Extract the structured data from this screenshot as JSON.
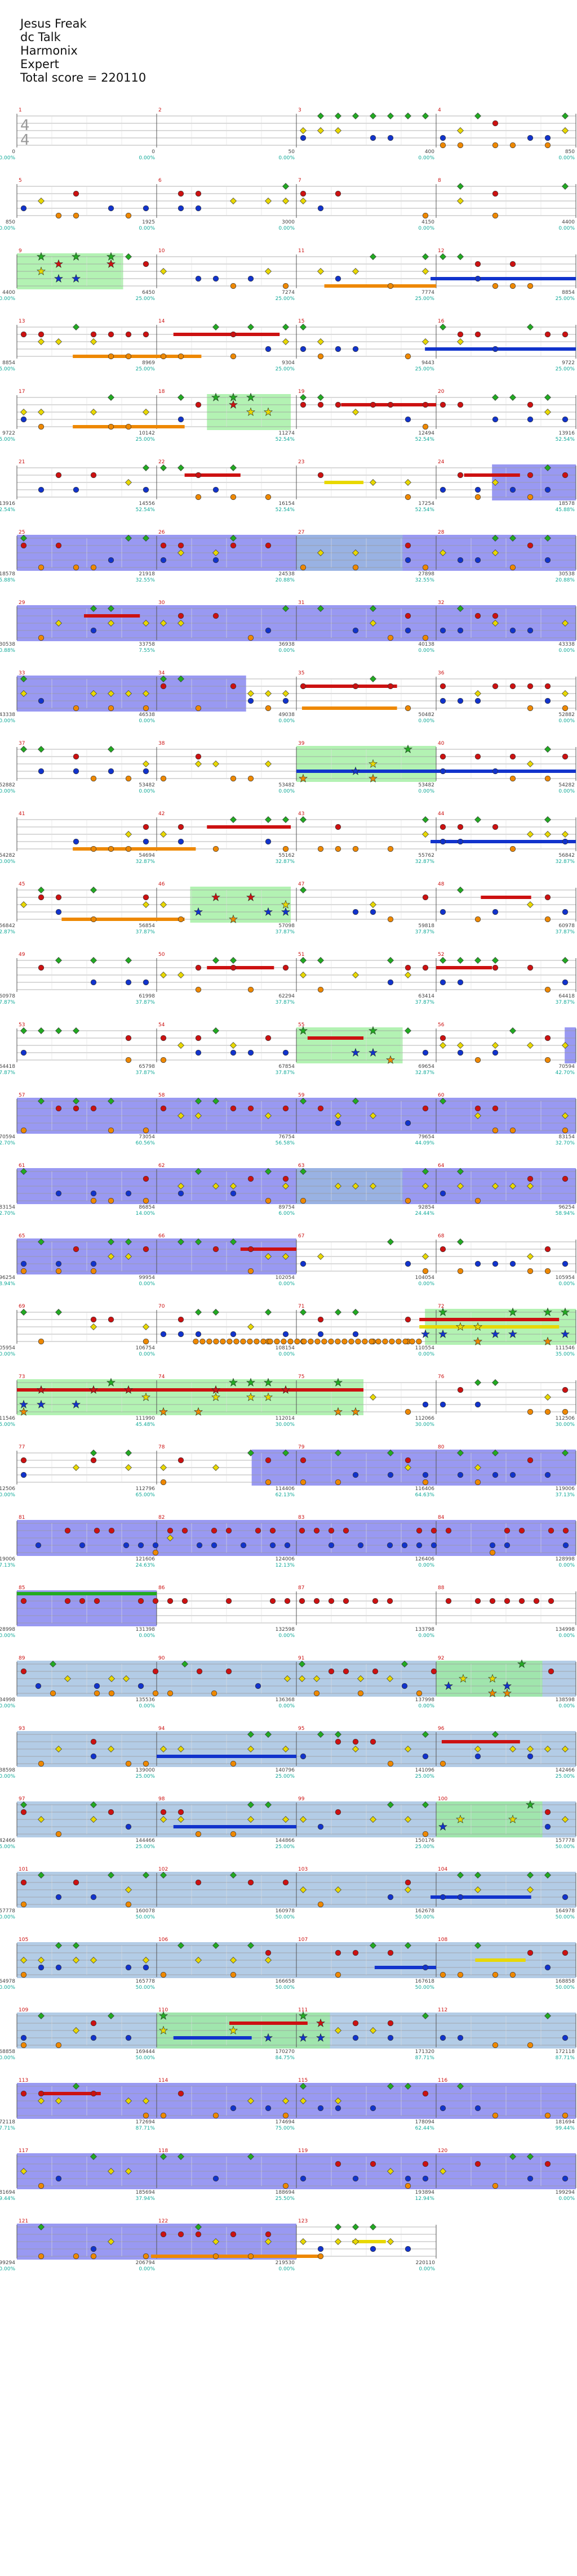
{
  "song": {
    "title": "Jesus Freak",
    "artist": "dc Talk",
    "charter": "Harmonix",
    "difficulty": "Expert",
    "total_score_text": "Total score = 220110"
  },
  "time_signature": "4/4",
  "lane_colors": [
    "#22aa22",
    "#cc1111",
    "#e8d800",
    "#1133cc",
    "#ee8800"
  ],
  "overlay_colors": {
    "star_power": "#99ee99",
    "overdrive": "#7777ee",
    "solo": "#99bbdd"
  },
  "rows": [
    {
      "bars": [
        {
          "n": 1,
          "score": "0",
          "pct": "0.00%"
        },
        {
          "n": 2,
          "score": "0",
          "pct": "0.00%"
        },
        {
          "n": 3,
          "score": "50",
          "pct": "0.00%"
        },
        {
          "n": 4,
          "score": "400",
          "pct": "0.00%"
        }
      ],
      "end_score": "850",
      "end_pct": "0.00%"
    },
    {
      "bars": [
        {
          "n": 5,
          "score": "850",
          "pct": "0.00%"
        },
        {
          "n": 6,
          "score": "1925",
          "pct": "0.00%"
        },
        {
          "n": 7,
          "score": "3000",
          "pct": "0.00%"
        },
        {
          "n": 8,
          "score": "4150",
          "pct": "0.00%"
        }
      ],
      "end_score": "4400",
      "end_pct": "0.00%"
    },
    {
      "bars": [
        {
          "n": 9,
          "score": "4400",
          "pct": "0.00%"
        },
        {
          "n": 10,
          "score": "6450",
          "pct": "25.00%"
        },
        {
          "n": 11,
          "score": "7274",
          "pct": "25.00%"
        },
        {
          "n": 12,
          "score": "7774",
          "pct": "25.00%"
        }
      ],
      "end_score": "8854",
      "end_pct": "25.00%"
    },
    {
      "bars": [
        {
          "n": 13,
          "score": "8854",
          "pct": "25.00%"
        },
        {
          "n": 14,
          "score": "8969",
          "pct": "25.00%"
        },
        {
          "n": 15,
          "score": "9304",
          "pct": "25.00%"
        },
        {
          "n": 16,
          "score": "9443",
          "pct": "25.00%"
        }
      ],
      "end_score": "9722",
      "end_pct": "25.00%"
    },
    {
      "bars": [
        {
          "n": 17,
          "score": "9722",
          "pct": "25.00%"
        },
        {
          "n": 18,
          "score": "10142",
          "pct": "25.00%"
        },
        {
          "n": 19,
          "score": "11274",
          "pct": "52.54%"
        },
        {
          "n": 20,
          "score": "12494",
          "pct": "52.54%"
        }
      ],
      "end_score": "13916",
      "end_pct": "52.54%"
    },
    {
      "bars": [
        {
          "n": 21,
          "score": "13916",
          "pct": "52.54%"
        },
        {
          "n": 22,
          "score": "14556",
          "pct": "52.54%"
        },
        {
          "n": 23,
          "score": "16154",
          "pct": "52.54%"
        },
        {
          "n": 24,
          "score": "17254",
          "pct": "52.54%"
        }
      ],
      "end_score": "18578",
      "end_pct": "45.88%"
    },
    {
      "bars": [
        {
          "n": 25,
          "score": "18578",
          "pct": "45.88%"
        },
        {
          "n": 26,
          "score": "21918",
          "pct": "32.55%"
        },
        {
          "n": 27,
          "score": "24538",
          "pct": "20.88%"
        },
        {
          "n": 28,
          "score": "27898",
          "pct": "32.55%"
        }
      ],
      "end_score": "30538",
      "end_pct": "20.88%"
    },
    {
      "bars": [
        {
          "n": 29,
          "score": "30538",
          "pct": "20.88%"
        },
        {
          "n": 30,
          "score": "33758",
          "pct": "7.55%"
        },
        {
          "n": 31,
          "score": "36938",
          "pct": "0.00%"
        },
        {
          "n": 32,
          "score": "40138",
          "pct": "0.00%"
        }
      ],
      "end_score": "43338",
      "end_pct": "0.00%"
    },
    {
      "bars": [
        {
          "n": 33,
          "score": "43338",
          "pct": "0.00%"
        },
        {
          "n": 34,
          "score": "46538",
          "pct": "0.00%"
        },
        {
          "n": 35,
          "score": "49038",
          "pct": "0.00%"
        },
        {
          "n": 36,
          "score": "50482",
          "pct": "0.00%"
        }
      ],
      "end_score": "52882",
      "end_pct": "0.00%"
    },
    {
      "bars": [
        {
          "n": 37,
          "score": "52882",
          "pct": "0.00%"
        },
        {
          "n": 38,
          "score": "53482",
          "pct": "0.00%"
        },
        {
          "n": 39,
          "score": "53482",
          "pct": "0.00%"
        },
        {
          "n": 40,
          "score": "53482",
          "pct": "0.00%"
        }
      ],
      "end_score": "54282",
      "end_pct": "0.00%"
    },
    {
      "bars": [
        {
          "n": 41,
          "score": "54282",
          "pct": "0.00%"
        },
        {
          "n": 42,
          "score": "54694",
          "pct": "32.87%"
        },
        {
          "n": 43,
          "score": "55162",
          "pct": "32.87%"
        },
        {
          "n": 44,
          "score": "55762",
          "pct": "32.87%"
        }
      ],
      "end_score": "56842",
      "end_pct": "32.87%"
    },
    {
      "bars": [
        {
          "n": 45,
          "score": "56842",
          "pct": "32.87%"
        },
        {
          "n": 46,
          "score": "56854",
          "pct": "37.87%"
        },
        {
          "n": 47,
          "score": "57098",
          "pct": "37.87%"
        },
        {
          "n": 48,
          "score": "59818",
          "pct": "37.87%"
        }
      ],
      "end_score": "60978",
      "end_pct": "37.87%"
    },
    {
      "bars": [
        {
          "n": 49,
          "score": "60978",
          "pct": "37.87%"
        },
        {
          "n": 50,
          "score": "61998",
          "pct": "37.87%"
        },
        {
          "n": 51,
          "score": "62294",
          "pct": "37.87%"
        },
        {
          "n": 52,
          "score": "63414",
          "pct": "37.87%"
        }
      ],
      "end_score": "64418",
      "end_pct": "37.87%"
    },
    {
      "bars": [
        {
          "n": 53,
          "score": "64418",
          "pct": "37.87%"
        },
        {
          "n": 54,
          "score": "65798",
          "pct": "37.87%"
        },
        {
          "n": 55,
          "score": "67854",
          "pct": "37.87%"
        },
        {
          "n": 56,
          "score": "69654",
          "pct": "32.87%"
        }
      ],
      "end_score": "70594",
      "end_pct": "42.70%"
    },
    {
      "bars": [
        {
          "n": 57,
          "score": "70594",
          "pct": "42.70%"
        },
        {
          "n": 58,
          "score": "73054",
          "pct": "60.56%"
        },
        {
          "n": 59,
          "score": "76754",
          "pct": "56.58%"
        },
        {
          "n": 60,
          "score": "79654",
          "pct": "44.09%"
        }
      ],
      "end_score": "83154",
      "end_pct": "32.70%"
    },
    {
      "bars": [
        {
          "n": 61,
          "score": "83154",
          "pct": "32.70%"
        },
        {
          "n": 62,
          "score": "86854",
          "pct": "14.00%"
        },
        {
          "n": 63,
          "score": "89754",
          "pct": "6.00%"
        },
        {
          "n": 64,
          "score": "92854",
          "pct": "24.44%"
        }
      ],
      "end_score": "96254",
      "end_pct": "58.94%"
    },
    {
      "bars": [
        {
          "n": 65,
          "score": "96254",
          "pct": "58.94%"
        },
        {
          "n": 66,
          "score": "99954",
          "pct": "0.00%"
        },
        {
          "n": 67,
          "score": "102054",
          "pct": "0.00%"
        },
        {
          "n": 68,
          "score": "104054",
          "pct": "0.00%"
        }
      ],
      "end_score": "105954",
      "end_pct": "0.00%"
    },
    {
      "bars": [
        {
          "n": 69,
          "score": "105954",
          "pct": "0.00%"
        },
        {
          "n": 70,
          "score": "106754",
          "pct": "0.00%"
        },
        {
          "n": 71,
          "score": "108154",
          "pct": "0.00%"
        },
        {
          "n": 72,
          "score": "110554",
          "pct": "0.00%"
        }
      ],
      "end_score": "111546",
      "end_pct": "35.00%"
    },
    {
      "bars": [
        {
          "n": 73,
          "score": "111546",
          "pct": "35.00%"
        },
        {
          "n": 74,
          "score": "111990",
          "pct": "45.48%"
        },
        {
          "n": 75,
          "score": "112014",
          "pct": "30.00%"
        },
        {
          "n": 76,
          "score": "112066",
          "pct": "30.00%"
        }
      ],
      "end_score": "112506",
      "end_pct": "30.00%"
    },
    {
      "bars": [
        {
          "n": 77,
          "score": "112506",
          "pct": "30.00%"
        },
        {
          "n": 78,
          "score": "112796",
          "pct": "65.00%"
        },
        {
          "n": 79,
          "score": "114406",
          "pct": "62.13%"
        },
        {
          "n": 80,
          "score": "116406",
          "pct": "64.63%"
        }
      ],
      "end_score": "119006",
      "end_pct": "37.13%"
    },
    {
      "bars": [
        {
          "n": 81,
          "score": "119006",
          "pct": "37.13%"
        },
        {
          "n": 82,
          "score": "121606",
          "pct": "24.63%"
        },
        {
          "n": 83,
          "score": "124006",
          "pct": "12.13%"
        },
        {
          "n": 84,
          "score": "126406",
          "pct": "0.00%"
        }
      ],
      "end_score": "128998",
      "end_pct": "0.00%"
    },
    {
      "bars": [
        {
          "n": 85,
          "score": "128998",
          "pct": "0.00%"
        },
        {
          "n": 86,
          "score": "131398",
          "pct": "0.00%"
        },
        {
          "n": 87,
          "score": "132598",
          "pct": "0.00%"
        },
        {
          "n": 88,
          "score": "133798",
          "pct": "0.00%"
        }
      ],
      "end_score": "134998",
      "end_pct": "0.00%"
    },
    {
      "bars": [
        {
          "n": 89,
          "score": "134998",
          "pct": "0.00%"
        },
        {
          "n": 90,
          "score": "135536",
          "pct": "0.00%"
        },
        {
          "n": 91,
          "score": "136368",
          "pct": "0.00%"
        },
        {
          "n": 92,
          "score": "137998",
          "pct": "0.00%"
        }
      ],
      "end_score": "138598",
      "end_pct": "0.00%"
    },
    {
      "bars": [
        {
          "n": 93,
          "score": "138598",
          "pct": "0.00%"
        },
        {
          "n": 94,
          "score": "139000",
          "pct": "25.00%"
        },
        {
          "n": 95,
          "score": "140796",
          "pct": "25.00%"
        },
        {
          "n": 96,
          "score": "141096",
          "pct": "25.00%"
        }
      ],
      "end_score": "142466",
      "end_pct": "25.00%"
    },
    {
      "bars": [
        {
          "n": 97,
          "score": "142466",
          "pct": "25.00%"
        },
        {
          "n": 98,
          "score": "144466",
          "pct": "25.00%"
        },
        {
          "n": 99,
          "score": "144866",
          "pct": "25.00%"
        },
        {
          "n": 100,
          "score": "150176",
          "pct": "25.00%"
        }
      ],
      "end_score": "157778",
      "end_pct": "50.00%"
    },
    {
      "bars": [
        {
          "n": 101,
          "score": "157778",
          "pct": "50.00%"
        },
        {
          "n": 102,
          "score": "160078",
          "pct": "50.00%"
        },
        {
          "n": 103,
          "score": "160978",
          "pct": "50.00%"
        },
        {
          "n": 104,
          "score": "162678",
          "pct": "50.00%"
        }
      ],
      "end_score": "164978",
      "end_pct": "50.00%"
    },
    {
      "bars": [
        {
          "n": 105,
          "score": "164978",
          "pct": "50.00%"
        },
        {
          "n": 106,
          "score": "165778",
          "pct": "50.00%"
        },
        {
          "n": 107,
          "score": "166658",
          "pct": "50.00%"
        },
        {
          "n": 108,
          "score": "167618",
          "pct": "50.00%"
        }
      ],
      "end_score": "168858",
      "end_pct": "50.00%"
    },
    {
      "bars": [
        {
          "n": 109,
          "score": "168858",
          "pct": "50.00%"
        },
        {
          "n": 110,
          "score": "169444",
          "pct": "50.00%"
        },
        {
          "n": 111,
          "score": "170270",
          "pct": "84.75%"
        },
        {
          "n": 112,
          "score": "171320",
          "pct": "87.71%"
        }
      ],
      "end_score": "172118",
      "end_pct": "87.71%"
    },
    {
      "bars": [
        {
          "n": 113,
          "score": "172118",
          "pct": "87.71%"
        },
        {
          "n": 114,
          "score": "172694",
          "pct": "87.71%"
        },
        {
          "n": 115,
          "score": "174694",
          "pct": "75.00%"
        },
        {
          "n": 116,
          "score": "178094",
          "pct": "62.44%"
        }
      ],
      "end_score": "181694",
      "end_pct": "99.44%"
    },
    {
      "bars": [
        {
          "n": 117,
          "score": "181694",
          "pct": "99.44%"
        },
        {
          "n": 118,
          "score": "185694",
          "pct": "37.94%"
        },
        {
          "n": 119,
          "score": "188694",
          "pct": "25.50%"
        },
        {
          "n": 120,
          "score": "193894",
          "pct": "12.94%"
        }
      ],
      "end_score": "199294",
      "end_pct": "0.00%"
    },
    {
      "bars": [
        {
          "n": 121,
          "score": "199294",
          "pct": "0.00%"
        },
        {
          "n": 122,
          "score": "206794",
          "pct": "0.00%"
        },
        {
          "n": 123,
          "score": "219530",
          "pct": "0.00%"
        }
      ],
      "end_score": "220110",
      "end_pct": "0.00%"
    }
  ]
}
